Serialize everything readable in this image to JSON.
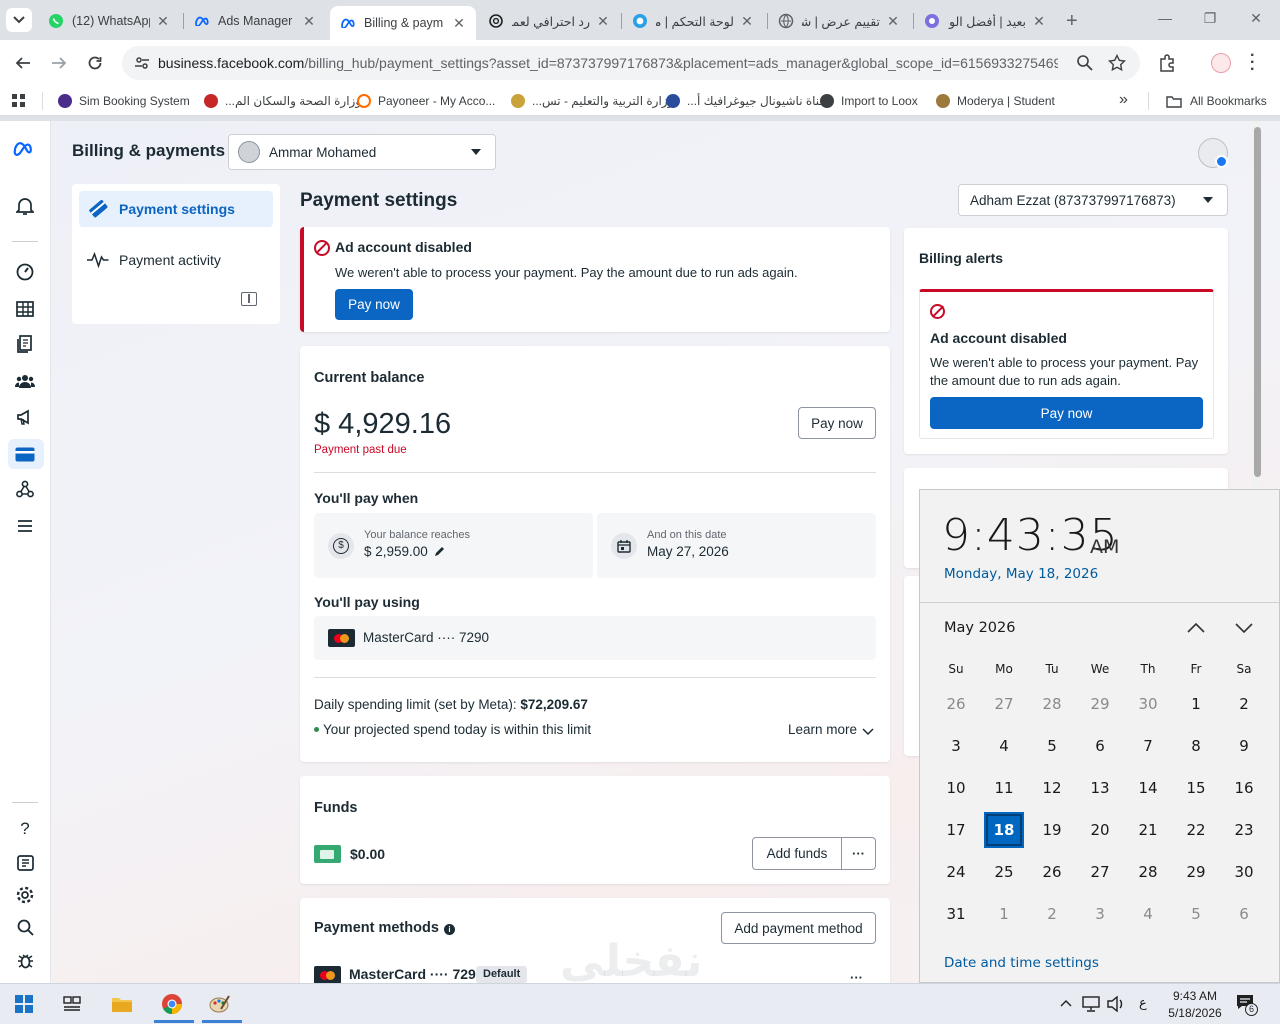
{
  "browser": {
    "tabs": [
      {
        "label": "(12) WhatsApp",
        "icon": "whatsapp-icon"
      },
      {
        "label": "Ads Manager",
        "icon": "meta-icon"
      },
      {
        "label": "Billing & paym",
        "icon": "meta-icon"
      },
      {
        "label": "رد احترافي لعميل",
        "icon": "openai-icon"
      },
      {
        "label": "لوحة التحكم | مستقل",
        "icon": "mostaql-icon"
      },
      {
        "label": "تقييم عرض | شقر",
        "icon": "globe-icon"
      },
      {
        "label": "بعيد | أفضل الوظا",
        "icon": "site-icon"
      }
    ],
    "url_host": "business.facebook.com",
    "url_rest": "/billing_hub/payment_settings?asset_id=873737997176873&placement=ads_manager&global_scope_id=6156933275469...",
    "bookmarks": [
      {
        "label": "Sim Booking System",
        "color": "#4b2c8a"
      },
      {
        "label": "وزارة الصحة والسكان الم...",
        "color": "#c62828"
      },
      {
        "label": "Payoneer - My Acco...",
        "color": "#ff6b00"
      },
      {
        "label": "وزارة التربية والتعليم - تس...",
        "color": "#caa23a"
      },
      {
        "label": "قناة ناشيونال جيوغرافيك أ...",
        "color": "#2a4d9b"
      },
      {
        "label": "Import to Loox",
        "color": "#3c4043"
      },
      {
        "label": "Moderya | Student",
        "color": "#9c7a3c"
      }
    ],
    "all_bookmarks": "All Bookmarks"
  },
  "header": {
    "title": "Billing & payments",
    "business_account": "Ammar Mohamed"
  },
  "sidenav": {
    "items": [
      {
        "label": "Payment settings"
      },
      {
        "label": "Payment activity"
      }
    ]
  },
  "main": {
    "title": "Payment settings",
    "ad_account": "Adham Ezzat (873737997176873)",
    "alert": {
      "title": "Ad account disabled",
      "message": "We weren't able to process your payment. Pay the amount due to run ads again.",
      "button": "Pay now"
    },
    "balance": {
      "heading": "Current balance",
      "amount": "$ 4,929.16",
      "status": "Payment past due",
      "button": "Pay now",
      "pay_when_heading": "You'll pay when",
      "threshold_label": "Your balance reaches",
      "threshold_value": "$ 2,959.00",
      "date_label": "And on this date",
      "date_value": "May 27, 2026",
      "pay_using_heading": "You'll pay using",
      "card": "MasterCard ···· 7290",
      "limit_label": "Daily spending limit (set by Meta): ",
      "limit_value": "$72,209.67",
      "projected": "Your projected spend today is within this limit",
      "learn_more": "Learn more"
    },
    "funds": {
      "heading": "Funds",
      "amount": "$0.00",
      "add_button": "Add funds",
      "more": "···"
    },
    "methods": {
      "heading": "Payment methods",
      "add_button": "Add payment method",
      "card": "MasterCard ···· 7290",
      "badge": "Default"
    }
  },
  "billing_alerts": {
    "heading": "Billing alerts",
    "title": "Ad account disabled",
    "message_line1": "We weren't able to process your payment. Pay",
    "message_line2": "the amount due to run ads again.",
    "button": "Pay now"
  },
  "watermark": "نفخلي",
  "clock": {
    "time": "9:43:35",
    "ampm": "AM",
    "date": "Monday, May 18, 2026",
    "month": "May 2026",
    "dow": [
      "Su",
      "Mo",
      "Tu",
      "We",
      "Th",
      "Fr",
      "Sa"
    ],
    "weeks": [
      [
        "26",
        "27",
        "28",
        "29",
        "30",
        "1",
        "2"
      ],
      [
        "3",
        "4",
        "5",
        "6",
        "7",
        "8",
        "9"
      ],
      [
        "10",
        "11",
        "12",
        "13",
        "14",
        "15",
        "16"
      ],
      [
        "17",
        "18",
        "19",
        "20",
        "21",
        "22",
        "23"
      ],
      [
        "24",
        "25",
        "26",
        "27",
        "28",
        "29",
        "30"
      ],
      [
        "31",
        "1",
        "2",
        "3",
        "4",
        "5",
        "6"
      ]
    ],
    "today": "18",
    "settings_link": "Date and time settings"
  },
  "taskbar": {
    "time": "9:43 AM",
    "date": "5/18/2026",
    "lang": "ع",
    "notifications": "6"
  }
}
